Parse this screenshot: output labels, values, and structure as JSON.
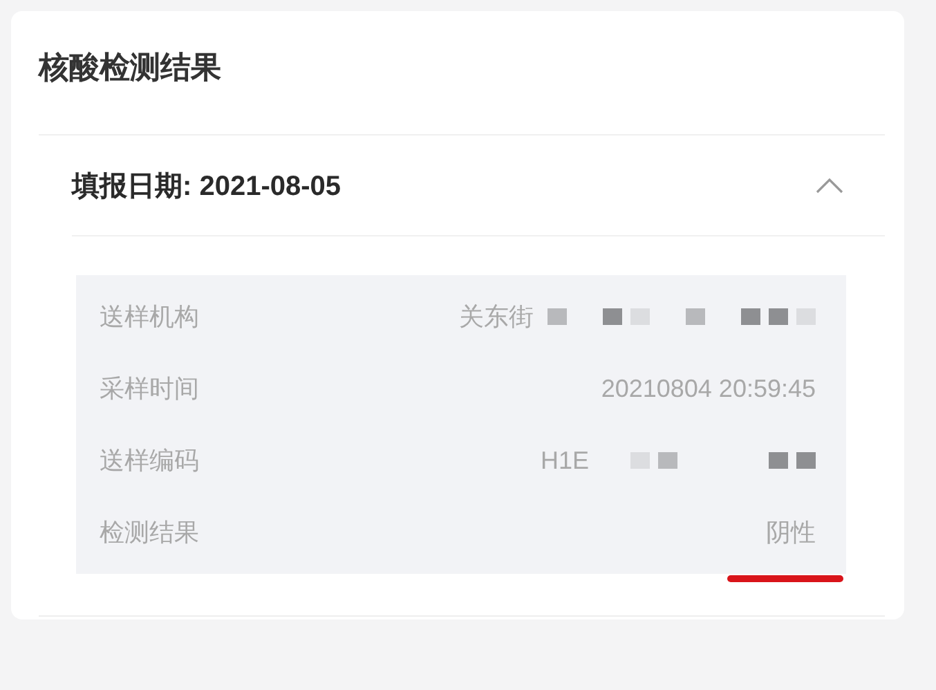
{
  "card": {
    "title": "核酸检测结果",
    "records": [
      {
        "date_label": "填报日期: 2021-08-05",
        "expanded": true,
        "fields": [
          {
            "label": "送样机构",
            "value": "关东街",
            "redacted": true
          },
          {
            "label": "采样时间",
            "value": "20210804 20:59:45",
            "redacted": false
          },
          {
            "label": "送样编码",
            "value": "H1E",
            "redacted": true
          },
          {
            "label": "检测结果",
            "value": "阴性",
            "redacted": false,
            "marked": true
          }
        ]
      }
    ]
  }
}
